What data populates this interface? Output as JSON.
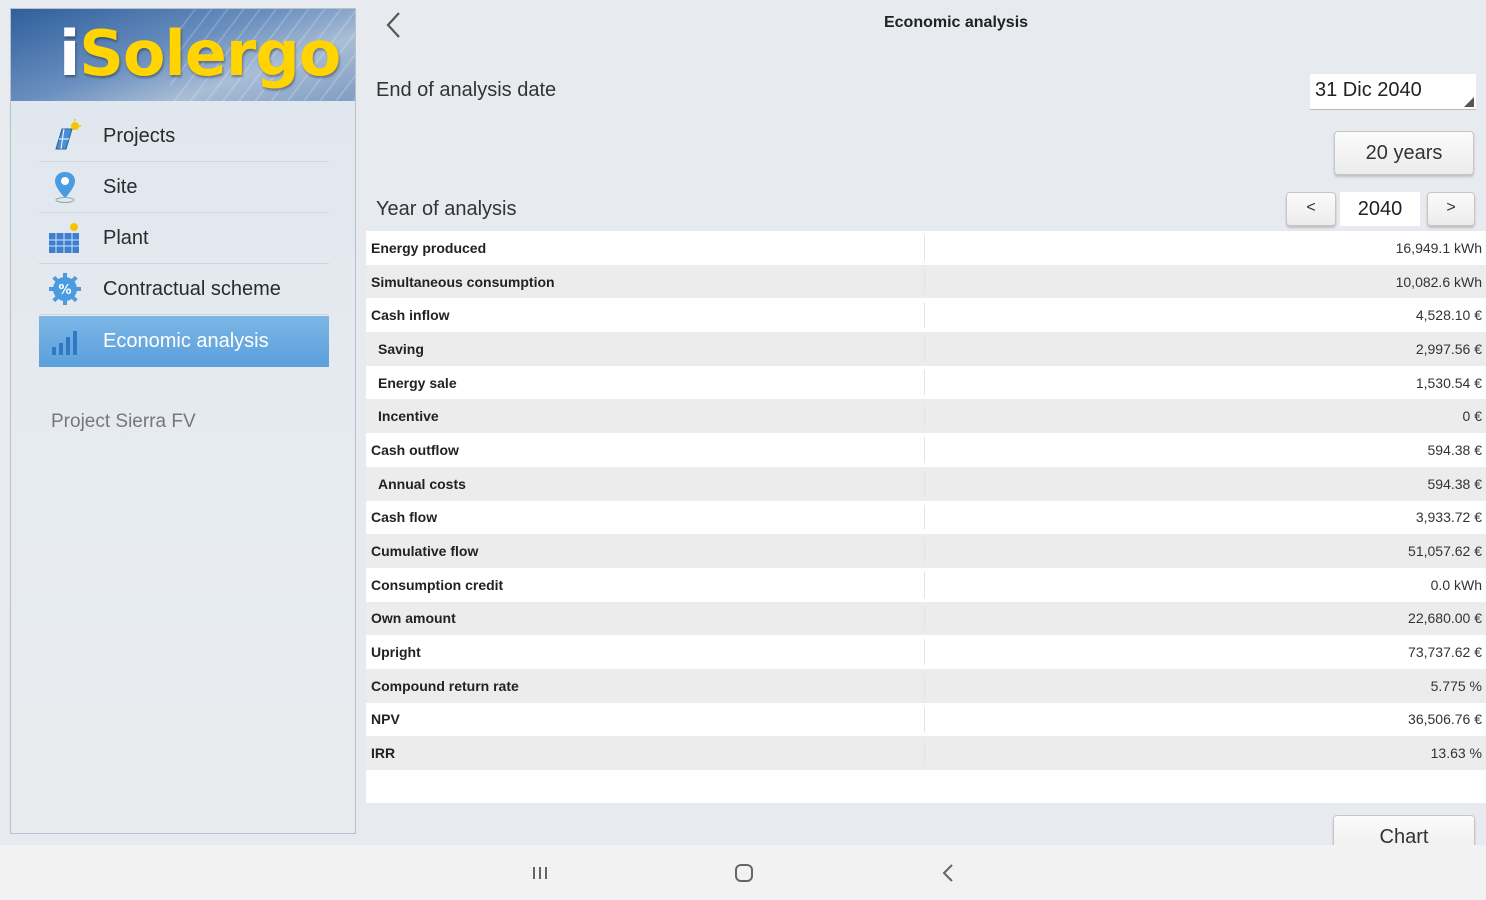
{
  "app": {
    "brand_i": "i",
    "brand_rest": "Solergo"
  },
  "sidebar": {
    "items": [
      {
        "label": "Projects",
        "icon": "solar-panel-icon"
      },
      {
        "label": "Site",
        "icon": "map-pin-icon"
      },
      {
        "label": "Plant",
        "icon": "solar-array-icon"
      },
      {
        "label": "Contractual scheme",
        "icon": "percent-gear-icon"
      },
      {
        "label": "Economic analysis",
        "icon": "bar-chart-icon",
        "active": true
      }
    ],
    "project_name": "Project Sierra FV"
  },
  "header": {
    "title": "Economic analysis"
  },
  "form": {
    "end_date_label": "End of analysis date",
    "end_date_value": "31 Dic 2040",
    "years_button": "20 years",
    "year_label": "Year of analysis",
    "year_value": "2040",
    "prev_label": "<",
    "next_label": ">"
  },
  "table": {
    "rows": [
      {
        "label": "Energy produced",
        "value": "16,949.1 kWh",
        "sub": false
      },
      {
        "label": "Simultaneous consumption",
        "value": "10,082.6 kWh",
        "sub": false
      },
      {
        "label": "Cash inflow",
        "value": "4,528.10 €",
        "sub": false
      },
      {
        "label": "Saving",
        "value": "2,997.56 €",
        "sub": true
      },
      {
        "label": "Energy sale",
        "value": "1,530.54 €",
        "sub": true
      },
      {
        "label": "Incentive",
        "value": "0 €",
        "sub": true
      },
      {
        "label": "Cash outflow",
        "value": "594.38 €",
        "sub": false
      },
      {
        "label": "Annual costs",
        "value": "594.38 €",
        "sub": true
      },
      {
        "label": "Cash flow",
        "value": "3,933.72 €",
        "sub": false
      },
      {
        "label": "Cumulative flow",
        "value": "51,057.62 €",
        "sub": false
      },
      {
        "label": "Consumption credit",
        "value": "0.0 kWh",
        "sub": false
      },
      {
        "label": "Own amount",
        "value": "22,680.00 €",
        "sub": false
      },
      {
        "label": "Upright",
        "value": "73,737.62 €",
        "sub": false
      },
      {
        "label": "Compound return rate",
        "value": "5.775 %",
        "sub": false
      },
      {
        "label": "NPV",
        "value": "36,506.76 €",
        "sub": false
      },
      {
        "label": "IRR",
        "value": "13.63 %",
        "sub": false
      }
    ]
  },
  "footer": {
    "chart_button": "Chart"
  },
  "colors": {
    "accent": "#5a9fdc",
    "brand_yellow": "#ffd400",
    "background": "#e7eaee"
  }
}
